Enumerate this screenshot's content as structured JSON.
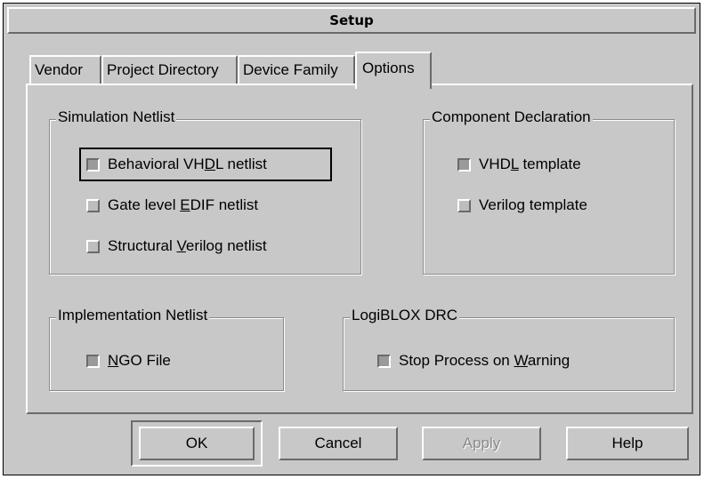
{
  "window": {
    "title": "Setup"
  },
  "tabs": [
    {
      "label": "Vendor",
      "active": false
    },
    {
      "label": "Project Directory",
      "active": false
    },
    {
      "label": "Device Family",
      "active": false
    },
    {
      "label": "Options",
      "active": true
    }
  ],
  "groups": {
    "simulation_netlist": {
      "title": "Simulation Netlist",
      "options": [
        {
          "pre": "Behavioral VH",
          "key": "D",
          "post": "L netlist",
          "checked": true,
          "focused": true
        },
        {
          "pre": "Gate level ",
          "key": "E",
          "post": "DIF netlist",
          "checked": false
        },
        {
          "pre": "Structural ",
          "key": "V",
          "post": "erilog netlist",
          "checked": false
        }
      ]
    },
    "component_declaration": {
      "title": "Component Declaration",
      "options": [
        {
          "pre": "VHD",
          "key": "L",
          "post": " template",
          "checked": true
        },
        {
          "pre": "Verilo",
          "key": "g",
          "post": " template",
          "checked": false
        }
      ]
    },
    "implementation_netlist": {
      "title": "Implementation Netlist",
      "options": [
        {
          "pre": "",
          "key": "N",
          "post": "GO File",
          "checked": true
        }
      ]
    },
    "logiblox_drc": {
      "title": "LogiBLOX DRC",
      "options": [
        {
          "pre": "Stop Process on ",
          "key": "W",
          "post": "arning",
          "checked": true
        }
      ]
    }
  },
  "buttons": {
    "ok": {
      "label": "OK",
      "default": true
    },
    "cancel": {
      "label": "Cancel"
    },
    "apply": {
      "label": "Apply",
      "enabled": false
    },
    "help": {
      "label": "Help"
    }
  },
  "colors": {
    "face": "#c8c8c8",
    "highlight": "#ffffff",
    "shadow": "#6a6a6a",
    "disabled_text": "#8a8a8a"
  }
}
